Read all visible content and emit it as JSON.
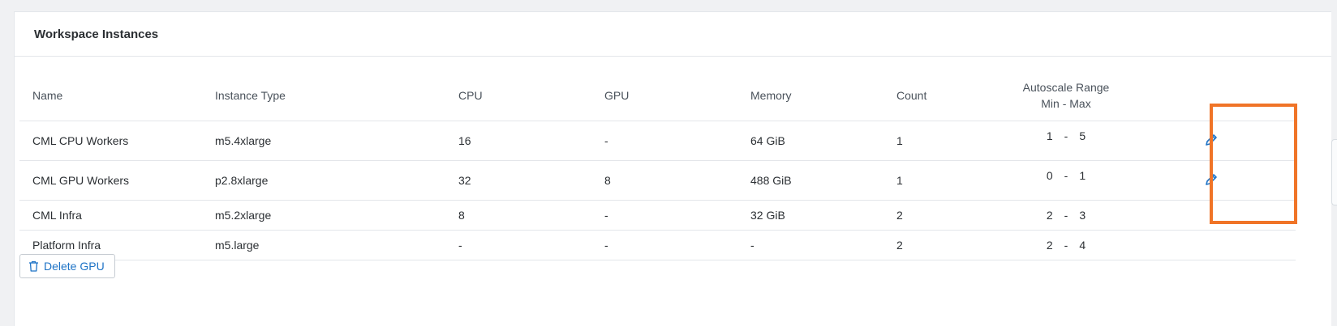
{
  "panel": {
    "title": "Workspace Instances"
  },
  "table": {
    "headers": {
      "name": "Name",
      "instance_type": "Instance Type",
      "cpu": "CPU",
      "gpu": "GPU",
      "memory": "Memory",
      "count": "Count",
      "autoscale_line1": "Autoscale Range",
      "autoscale_line2": "Min - Max"
    },
    "rows": [
      {
        "name": "CML CPU Workers",
        "instance_type": "m5.4xlarge",
        "cpu": "16",
        "gpu": "-",
        "memory": "64 GiB",
        "count": "1",
        "min": "1",
        "sep": "-",
        "max": "5",
        "editable": true
      },
      {
        "name": "CML GPU Workers",
        "instance_type": "p2.8xlarge",
        "cpu": "32",
        "gpu": "8",
        "memory": "488 GiB",
        "count": "1",
        "min": "0",
        "sep": "-",
        "max": "1",
        "editable": true
      },
      {
        "name": "CML Infra",
        "instance_type": "m5.2xlarge",
        "cpu": "8",
        "gpu": "-",
        "memory": "32 GiB",
        "count": "2",
        "min": "2",
        "sep": "-",
        "max": "3",
        "editable": false
      },
      {
        "name": "Platform Infra",
        "instance_type": "m5.large",
        "cpu": "-",
        "gpu": "-",
        "memory": "-",
        "count": "2",
        "min": "2",
        "sep": "-",
        "max": "4",
        "editable": false
      }
    ]
  },
  "actions": {
    "delete_gpu_label": "Delete GPU",
    "delete_icon": "trash-icon",
    "edit_icon": "pencil-icon"
  },
  "colors": {
    "accent": "#1e73c6",
    "highlight": "#f07427"
  }
}
